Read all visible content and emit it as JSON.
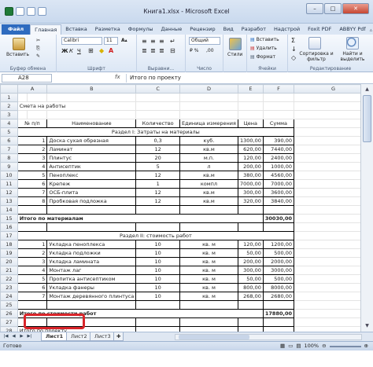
{
  "window": {
    "title": "Книга1.xlsx - Microsoft Excel",
    "buttons": {
      "minimize": "–",
      "maximize": "□",
      "close": "✕"
    }
  },
  "tabs": [
    "Файл",
    "Главная",
    "Вставка",
    "Разметка",
    "Формулы",
    "Данные",
    "Рецензир",
    "Вид",
    "Разработ",
    "Надстрой",
    "Foxit PDF",
    "ABBYY Pdf"
  ],
  "ribbon": {
    "paste": "Вставить",
    "font_name": "Calibri",
    "font_size": "11",
    "number_format": "Общий",
    "styles": "Стили",
    "insert": "Вставить",
    "delete": "Удалить",
    "format": "Формат",
    "sort": "Сортировка и фильтр",
    "find": "Найти и выделить",
    "groups": {
      "clipboard": "Буфер обмена",
      "font": "Шрифт",
      "alignment": "Выравни...",
      "number": "Число",
      "cells": "Ячейки",
      "editing": "Редактирование"
    }
  },
  "formula_bar": {
    "cell_ref": "A28",
    "fx": "fx",
    "content": "Итого по проекту"
  },
  "grid": {
    "columns": [
      "A",
      "B",
      "C",
      "D",
      "E",
      "F",
      "G"
    ],
    "rows": [
      {
        "n": "1",
        "cells": []
      },
      {
        "n": "2",
        "cells": [
          {
            "t": "Смета на работы",
            "cls": "",
            "span": 2
          }
        ]
      },
      {
        "n": "3",
        "cells": []
      },
      {
        "n": "4",
        "cells": [
          {
            "t": "№ п/п",
            "cls": "c"
          },
          {
            "t": "Наименование",
            "cls": "c"
          },
          {
            "t": "Количество",
            "cls": "c"
          },
          {
            "t": "Единица измерения",
            "cls": "c"
          },
          {
            "t": "Цена",
            "cls": "c"
          },
          {
            "t": "Сумма",
            "cls": "c"
          }
        ]
      },
      {
        "n": "5",
        "cells": [
          {
            "t": "Раздел I: Затраты на материалы",
            "cls": "c",
            "span": 6
          }
        ]
      },
      {
        "n": "6",
        "cells": [
          {
            "t": "1",
            "cls": "r"
          },
          {
            "t": "Доска сухая обрезная"
          },
          {
            "t": "0,3",
            "cls": "c"
          },
          {
            "t": "куб.",
            "cls": "c"
          },
          {
            "t": "1300,00",
            "cls": "r"
          },
          {
            "t": "390,00",
            "cls": "r"
          }
        ]
      },
      {
        "n": "7",
        "cells": [
          {
            "t": "2",
            "cls": "r"
          },
          {
            "t": "Ламинат"
          },
          {
            "t": "12",
            "cls": "c"
          },
          {
            "t": "кв.м",
            "cls": "c"
          },
          {
            "t": "620,00",
            "cls": "r"
          },
          {
            "t": "7440,00",
            "cls": "r"
          }
        ]
      },
      {
        "n": "8",
        "cells": [
          {
            "t": "3",
            "cls": "r"
          },
          {
            "t": "Плинтус"
          },
          {
            "t": "20",
            "cls": "c"
          },
          {
            "t": "м.п.",
            "cls": "c"
          },
          {
            "t": "120,00",
            "cls": "r"
          },
          {
            "t": "2400,00",
            "cls": "r"
          }
        ]
      },
      {
        "n": "9",
        "cells": [
          {
            "t": "4",
            "cls": "r"
          },
          {
            "t": "Антисептик"
          },
          {
            "t": "5",
            "cls": "c"
          },
          {
            "t": "л",
            "cls": "c"
          },
          {
            "t": "200,00",
            "cls": "r"
          },
          {
            "t": "1000,00",
            "cls": "r"
          }
        ]
      },
      {
        "n": "10",
        "cells": [
          {
            "t": "5",
            "cls": "r"
          },
          {
            "t": "Пеноплекс"
          },
          {
            "t": "12",
            "cls": "c"
          },
          {
            "t": "кв.м",
            "cls": "c"
          },
          {
            "t": "380,00",
            "cls": "r"
          },
          {
            "t": "4560,00",
            "cls": "r"
          }
        ]
      },
      {
        "n": "11",
        "cells": [
          {
            "t": "6",
            "cls": "r"
          },
          {
            "t": "Крепеж"
          },
          {
            "t": "1",
            "cls": "c"
          },
          {
            "t": "компл",
            "cls": "c"
          },
          {
            "t": "7000,00",
            "cls": "r"
          },
          {
            "t": "7000,00",
            "cls": "r"
          }
        ]
      },
      {
        "n": "12",
        "cells": [
          {
            "t": "7",
            "cls": "r"
          },
          {
            "t": "ОСБ-плита"
          },
          {
            "t": "12",
            "cls": "c"
          },
          {
            "t": "кв.м",
            "cls": "c"
          },
          {
            "t": "300,00",
            "cls": "r"
          },
          {
            "t": "3600,00",
            "cls": "r"
          }
        ]
      },
      {
        "n": "13",
        "cells": [
          {
            "t": "8",
            "cls": "r"
          },
          {
            "t": "Пробковая подложка"
          },
          {
            "t": "12",
            "cls": "c"
          },
          {
            "t": "кв.м",
            "cls": "c"
          },
          {
            "t": "320,00",
            "cls": "r"
          },
          {
            "t": "3840,00",
            "cls": "r"
          }
        ]
      },
      {
        "n": "14",
        "cells": [
          {
            "t": ""
          },
          {
            "t": ""
          },
          {
            "t": ""
          },
          {
            "t": ""
          },
          {
            "t": ""
          },
          {
            "t": ""
          }
        ]
      },
      {
        "n": "15",
        "cells": [
          {
            "t": "Итого по материалам",
            "cls": "b",
            "span": 5
          },
          {
            "t": "30030,00",
            "cls": "r b"
          }
        ]
      },
      {
        "n": "16",
        "cells": [
          {
            "t": ""
          },
          {
            "t": ""
          },
          {
            "t": ""
          },
          {
            "t": ""
          },
          {
            "t": ""
          },
          {
            "t": ""
          }
        ]
      },
      {
        "n": "17",
        "cells": [
          {
            "t": "Раздел II: стоимость работ",
            "cls": "c",
            "span": 6
          }
        ]
      },
      {
        "n": "18",
        "cells": [
          {
            "t": "1",
            "cls": "r"
          },
          {
            "t": "Укладка пеноплекса"
          },
          {
            "t": "10",
            "cls": "c"
          },
          {
            "t": "кв. м",
            "cls": "c"
          },
          {
            "t": "120,00",
            "cls": "r"
          },
          {
            "t": "1200,00",
            "cls": "r"
          }
        ]
      },
      {
        "n": "19",
        "cells": [
          {
            "t": "2",
            "cls": "r"
          },
          {
            "t": "Укладка подложки"
          },
          {
            "t": "10",
            "cls": "c"
          },
          {
            "t": "кв. м",
            "cls": "c"
          },
          {
            "t": "50,00",
            "cls": "r"
          },
          {
            "t": "500,00",
            "cls": "r"
          }
        ]
      },
      {
        "n": "20",
        "cells": [
          {
            "t": "3",
            "cls": "r"
          },
          {
            "t": "Укладка ламината"
          },
          {
            "t": "10",
            "cls": "c"
          },
          {
            "t": "кв. м",
            "cls": "c"
          },
          {
            "t": "200,00",
            "cls": "r"
          },
          {
            "t": "2000,00",
            "cls": "r"
          }
        ]
      },
      {
        "n": "21",
        "cells": [
          {
            "t": "4",
            "cls": "r"
          },
          {
            "t": "Монтаж лаг"
          },
          {
            "t": "10",
            "cls": "c"
          },
          {
            "t": "кв. м",
            "cls": "c"
          },
          {
            "t": "300,00",
            "cls": "r"
          },
          {
            "t": "3000,00",
            "cls": "r"
          }
        ]
      },
      {
        "n": "22",
        "cells": [
          {
            "t": "5",
            "cls": "r"
          },
          {
            "t": "Пропитка антисептиком"
          },
          {
            "t": "10",
            "cls": "c"
          },
          {
            "t": "кв. м",
            "cls": "c"
          },
          {
            "t": "50,00",
            "cls": "r"
          },
          {
            "t": "500,00",
            "cls": "r"
          }
        ]
      },
      {
        "n": "23",
        "cells": [
          {
            "t": "6",
            "cls": "r"
          },
          {
            "t": "Укладка фанеры"
          },
          {
            "t": "10",
            "cls": "c"
          },
          {
            "t": "кв. м",
            "cls": "c"
          },
          {
            "t": "800,00",
            "cls": "r"
          },
          {
            "t": "8000,00",
            "cls": "r"
          }
        ]
      },
      {
        "n": "24",
        "cells": [
          {
            "t": "7",
            "cls": "r"
          },
          {
            "t": "Монтаж деревянного плинтуса"
          },
          {
            "t": "10",
            "cls": "c"
          },
          {
            "t": "кв. м",
            "cls": "c"
          },
          {
            "t": "268,00",
            "cls": "r"
          },
          {
            "t": "2680,00",
            "cls": "r"
          }
        ]
      },
      {
        "n": "25",
        "cells": [
          {
            "t": ""
          },
          {
            "t": ""
          },
          {
            "t": ""
          },
          {
            "t": ""
          },
          {
            "t": ""
          },
          {
            "t": ""
          }
        ]
      },
      {
        "n": "26",
        "cells": [
          {
            "t": "Итого по стоимости работ",
            "cls": "b",
            "span": 5
          },
          {
            "t": "17880,00",
            "cls": "r b"
          }
        ]
      },
      {
        "n": "27",
        "cells": [
          {
            "t": ""
          },
          {
            "t": ""
          },
          {
            "t": ""
          },
          {
            "t": ""
          },
          {
            "t": ""
          },
          {
            "t": ""
          }
        ]
      },
      {
        "n": "28",
        "cells": [
          {
            "t": "Итого по проекту",
            "span": 2
          },
          {
            "t": ""
          },
          {
            "t": ""
          },
          {
            "t": ""
          },
          {
            "t": ""
          }
        ]
      },
      {
        "n": "29",
        "cells": []
      }
    ]
  },
  "sheets": [
    "Лист1",
    "Лист2",
    "Лист3"
  ],
  "status": {
    "ready": "Готово",
    "zoom": "100%"
  }
}
